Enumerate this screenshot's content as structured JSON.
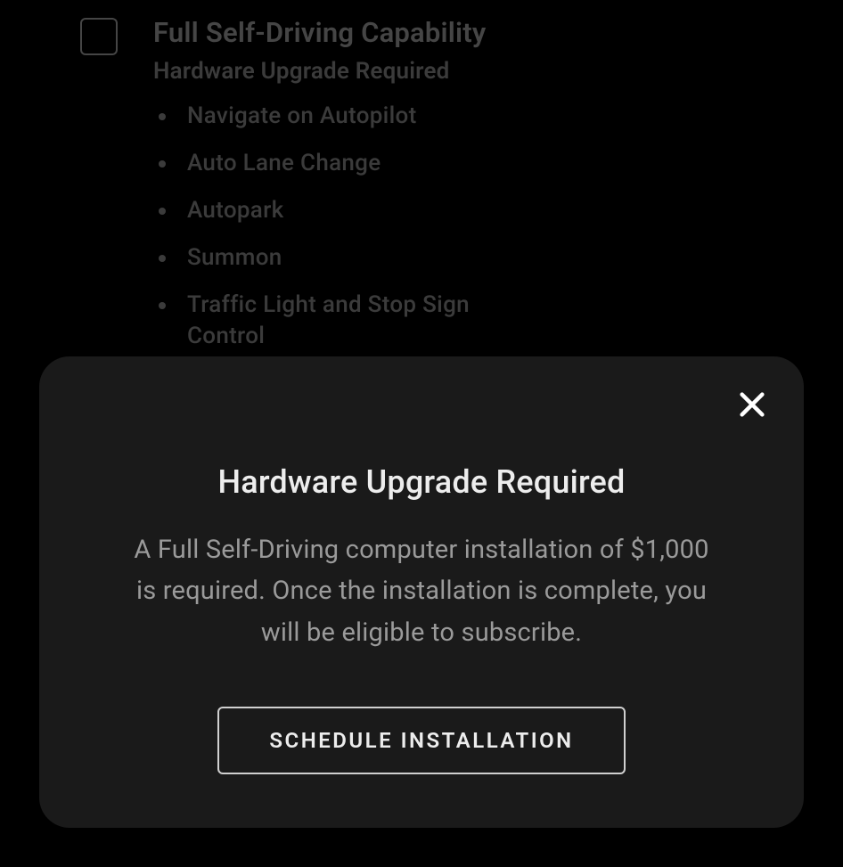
{
  "option": {
    "title": "Full Self-Driving Capability",
    "subtitle": "Hardware Upgrade Required",
    "features": [
      "Navigate on Autopilot",
      "Auto Lane Change",
      "Autopark",
      "Summon",
      "Traffic Light and Stop Sign Control"
    ]
  },
  "modal": {
    "title": "Hardware Upgrade Required",
    "body": "A Full Self-Driving computer installation of $1,000 is required. Once the installation is complete, you will be eligible to subscribe.",
    "button_label": "SCHEDULE INSTALLATION"
  }
}
